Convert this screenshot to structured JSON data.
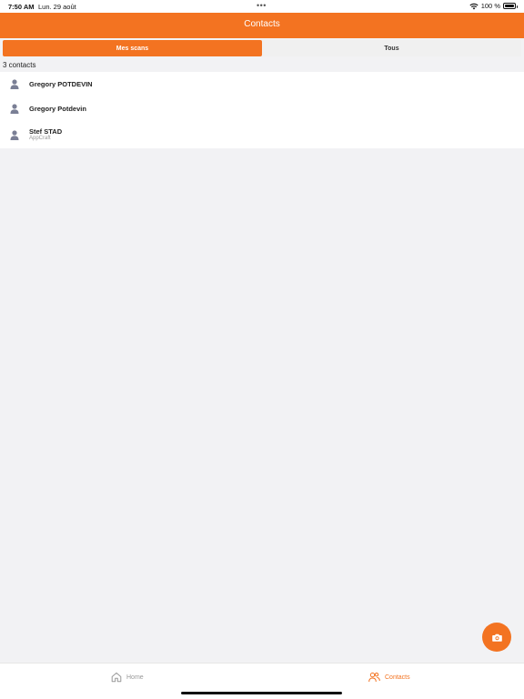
{
  "status_bar": {
    "time": "7:50 AM",
    "date": "Lun. 29 août",
    "multitask_dots": "•••",
    "battery_text": "100 %"
  },
  "header": {
    "title": "Contacts"
  },
  "tabs": [
    {
      "label": "Mes scans",
      "active": true
    },
    {
      "label": "Tous",
      "active": false
    }
  ],
  "contacts_count": "3 contacts",
  "contacts": [
    {
      "name": "Gregory POTDEVIN",
      "company": ""
    },
    {
      "name": "Gregory Potdevin",
      "company": ""
    },
    {
      "name": "Stef STAD",
      "company": "AppCraft"
    }
  ],
  "fab": {
    "icon": "camera-icon"
  },
  "bottom_nav": {
    "home_label": "Home",
    "contacts_label": "Contacts"
  },
  "colors": {
    "accent": "#f37321",
    "background": "#f2f2f4",
    "inactive": "#999999"
  }
}
